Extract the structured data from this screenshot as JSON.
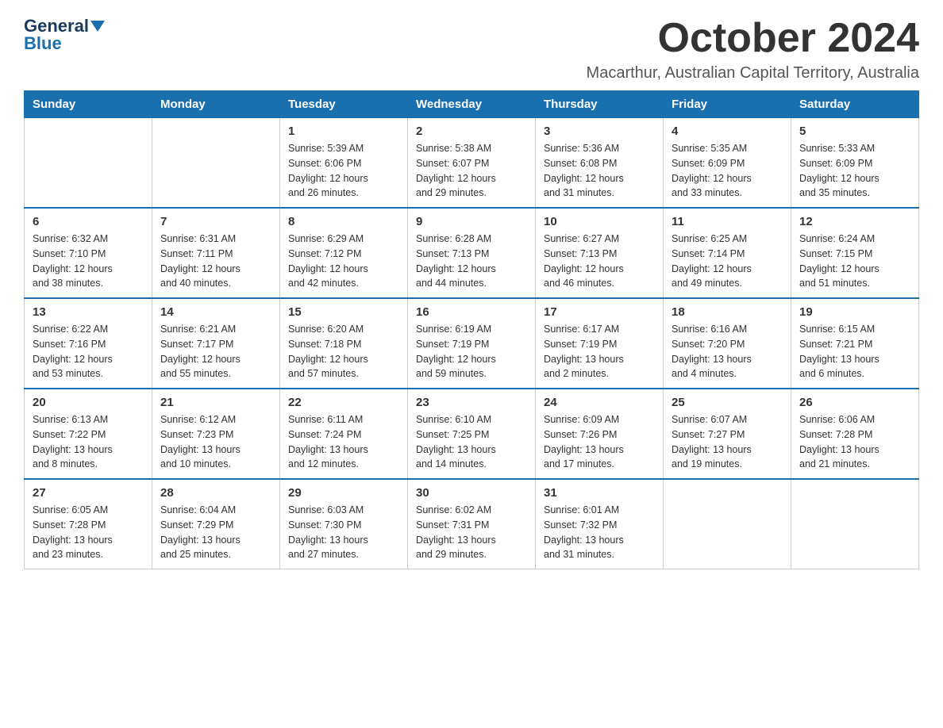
{
  "logo": {
    "text_general": "General",
    "text_blue": "Blue"
  },
  "title": "October 2024",
  "location": "Macarthur, Australian Capital Territory, Australia",
  "days_of_week": [
    "Sunday",
    "Monday",
    "Tuesday",
    "Wednesday",
    "Thursday",
    "Friday",
    "Saturday"
  ],
  "weeks": [
    [
      {
        "day": "",
        "info": ""
      },
      {
        "day": "",
        "info": ""
      },
      {
        "day": "1",
        "info": "Sunrise: 5:39 AM\nSunset: 6:06 PM\nDaylight: 12 hours\nand 26 minutes."
      },
      {
        "day": "2",
        "info": "Sunrise: 5:38 AM\nSunset: 6:07 PM\nDaylight: 12 hours\nand 29 minutes."
      },
      {
        "day": "3",
        "info": "Sunrise: 5:36 AM\nSunset: 6:08 PM\nDaylight: 12 hours\nand 31 minutes."
      },
      {
        "day": "4",
        "info": "Sunrise: 5:35 AM\nSunset: 6:09 PM\nDaylight: 12 hours\nand 33 minutes."
      },
      {
        "day": "5",
        "info": "Sunrise: 5:33 AM\nSunset: 6:09 PM\nDaylight: 12 hours\nand 35 minutes."
      }
    ],
    [
      {
        "day": "6",
        "info": "Sunrise: 6:32 AM\nSunset: 7:10 PM\nDaylight: 12 hours\nand 38 minutes."
      },
      {
        "day": "7",
        "info": "Sunrise: 6:31 AM\nSunset: 7:11 PM\nDaylight: 12 hours\nand 40 minutes."
      },
      {
        "day": "8",
        "info": "Sunrise: 6:29 AM\nSunset: 7:12 PM\nDaylight: 12 hours\nand 42 minutes."
      },
      {
        "day": "9",
        "info": "Sunrise: 6:28 AM\nSunset: 7:13 PM\nDaylight: 12 hours\nand 44 minutes."
      },
      {
        "day": "10",
        "info": "Sunrise: 6:27 AM\nSunset: 7:13 PM\nDaylight: 12 hours\nand 46 minutes."
      },
      {
        "day": "11",
        "info": "Sunrise: 6:25 AM\nSunset: 7:14 PM\nDaylight: 12 hours\nand 49 minutes."
      },
      {
        "day": "12",
        "info": "Sunrise: 6:24 AM\nSunset: 7:15 PM\nDaylight: 12 hours\nand 51 minutes."
      }
    ],
    [
      {
        "day": "13",
        "info": "Sunrise: 6:22 AM\nSunset: 7:16 PM\nDaylight: 12 hours\nand 53 minutes."
      },
      {
        "day": "14",
        "info": "Sunrise: 6:21 AM\nSunset: 7:17 PM\nDaylight: 12 hours\nand 55 minutes."
      },
      {
        "day": "15",
        "info": "Sunrise: 6:20 AM\nSunset: 7:18 PM\nDaylight: 12 hours\nand 57 minutes."
      },
      {
        "day": "16",
        "info": "Sunrise: 6:19 AM\nSunset: 7:19 PM\nDaylight: 12 hours\nand 59 minutes."
      },
      {
        "day": "17",
        "info": "Sunrise: 6:17 AM\nSunset: 7:19 PM\nDaylight: 13 hours\nand 2 minutes."
      },
      {
        "day": "18",
        "info": "Sunrise: 6:16 AM\nSunset: 7:20 PM\nDaylight: 13 hours\nand 4 minutes."
      },
      {
        "day": "19",
        "info": "Sunrise: 6:15 AM\nSunset: 7:21 PM\nDaylight: 13 hours\nand 6 minutes."
      }
    ],
    [
      {
        "day": "20",
        "info": "Sunrise: 6:13 AM\nSunset: 7:22 PM\nDaylight: 13 hours\nand 8 minutes."
      },
      {
        "day": "21",
        "info": "Sunrise: 6:12 AM\nSunset: 7:23 PM\nDaylight: 13 hours\nand 10 minutes."
      },
      {
        "day": "22",
        "info": "Sunrise: 6:11 AM\nSunset: 7:24 PM\nDaylight: 13 hours\nand 12 minutes."
      },
      {
        "day": "23",
        "info": "Sunrise: 6:10 AM\nSunset: 7:25 PM\nDaylight: 13 hours\nand 14 minutes."
      },
      {
        "day": "24",
        "info": "Sunrise: 6:09 AM\nSunset: 7:26 PM\nDaylight: 13 hours\nand 17 minutes."
      },
      {
        "day": "25",
        "info": "Sunrise: 6:07 AM\nSunset: 7:27 PM\nDaylight: 13 hours\nand 19 minutes."
      },
      {
        "day": "26",
        "info": "Sunrise: 6:06 AM\nSunset: 7:28 PM\nDaylight: 13 hours\nand 21 minutes."
      }
    ],
    [
      {
        "day": "27",
        "info": "Sunrise: 6:05 AM\nSunset: 7:28 PM\nDaylight: 13 hours\nand 23 minutes."
      },
      {
        "day": "28",
        "info": "Sunrise: 6:04 AM\nSunset: 7:29 PM\nDaylight: 13 hours\nand 25 minutes."
      },
      {
        "day": "29",
        "info": "Sunrise: 6:03 AM\nSunset: 7:30 PM\nDaylight: 13 hours\nand 27 minutes."
      },
      {
        "day": "30",
        "info": "Sunrise: 6:02 AM\nSunset: 7:31 PM\nDaylight: 13 hours\nand 29 minutes."
      },
      {
        "day": "31",
        "info": "Sunrise: 6:01 AM\nSunset: 7:32 PM\nDaylight: 13 hours\nand 31 minutes."
      },
      {
        "day": "",
        "info": ""
      },
      {
        "day": "",
        "info": ""
      }
    ]
  ]
}
